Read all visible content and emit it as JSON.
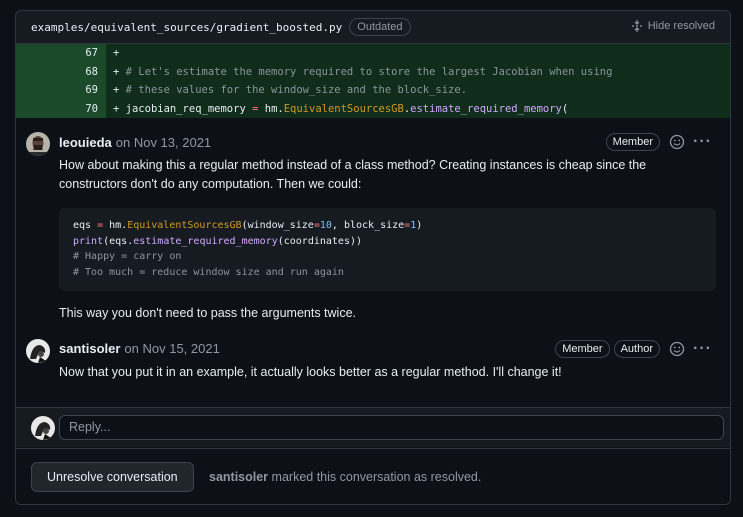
{
  "file": {
    "path": "examples/equivalent_sources/gradient_boosted.py",
    "outdated_label": "Outdated",
    "hide_resolved_label": "Hide resolved"
  },
  "diff": {
    "line_numbers": [
      "67",
      "68",
      "69",
      "70"
    ],
    "line2_prefix": "+ ",
    "line2_text": "# Let's estimate the memory required to store the largest Jacobian when using",
    "line3_text": "# these values for the window_size and the block_size.",
    "line4_var": "jacobian_req_memory",
    "line4_eq": "=",
    "line4_obj": "hm.",
    "line4_cls": "EquivalentSourcesGB",
    "line4_dot": ".",
    "line4_fn": "estimate_required_memory",
    "line4_paren": "(",
    "plus": "+"
  },
  "comments": [
    {
      "author": "leouieda",
      "date": "on Nov 13, 2021",
      "badges": [
        "Member"
      ],
      "text1": "How about making this a regular method instead of a class method? Creating instances is cheap since the constructors don't do any computation. Then we could:",
      "text2": "This way you don't need to pass the arguments twice."
    },
    {
      "author": "santisoler",
      "date": "on Nov 15, 2021",
      "badges": [
        "Member",
        "Author"
      ],
      "text1": "Now that you put it in an example, it actually looks better as a regular method. I'll change it!"
    }
  ],
  "code": {
    "l1_var": "eqs",
    "l1_eq": " = ",
    "l1_obj": "hm.",
    "l1_cls": "EquivalentSourcesGB",
    "l1_a": "(window_size",
    "l1_eq2": "=",
    "l1_n1": "10",
    "l1_b": ", block_size",
    "l1_eq3": "=",
    "l1_n2": "1",
    "l1_c": ")",
    "l2_fn": "print",
    "l2_a": "(eqs.",
    "l2_fn2": "estimate_required_memory",
    "l2_b": "(coordinates))",
    "l3": "# Happy = carry on",
    "l4": "# Too much = reduce window size and run again"
  },
  "reply": {
    "placeholder": "Reply..."
  },
  "footer": {
    "button_label": "Unresolve conversation",
    "resolver": "santisoler",
    "resolved_text": " marked this conversation as resolved."
  },
  "colors": {
    "accent_green": "#0f2d1a",
    "background": "#0d1117"
  }
}
